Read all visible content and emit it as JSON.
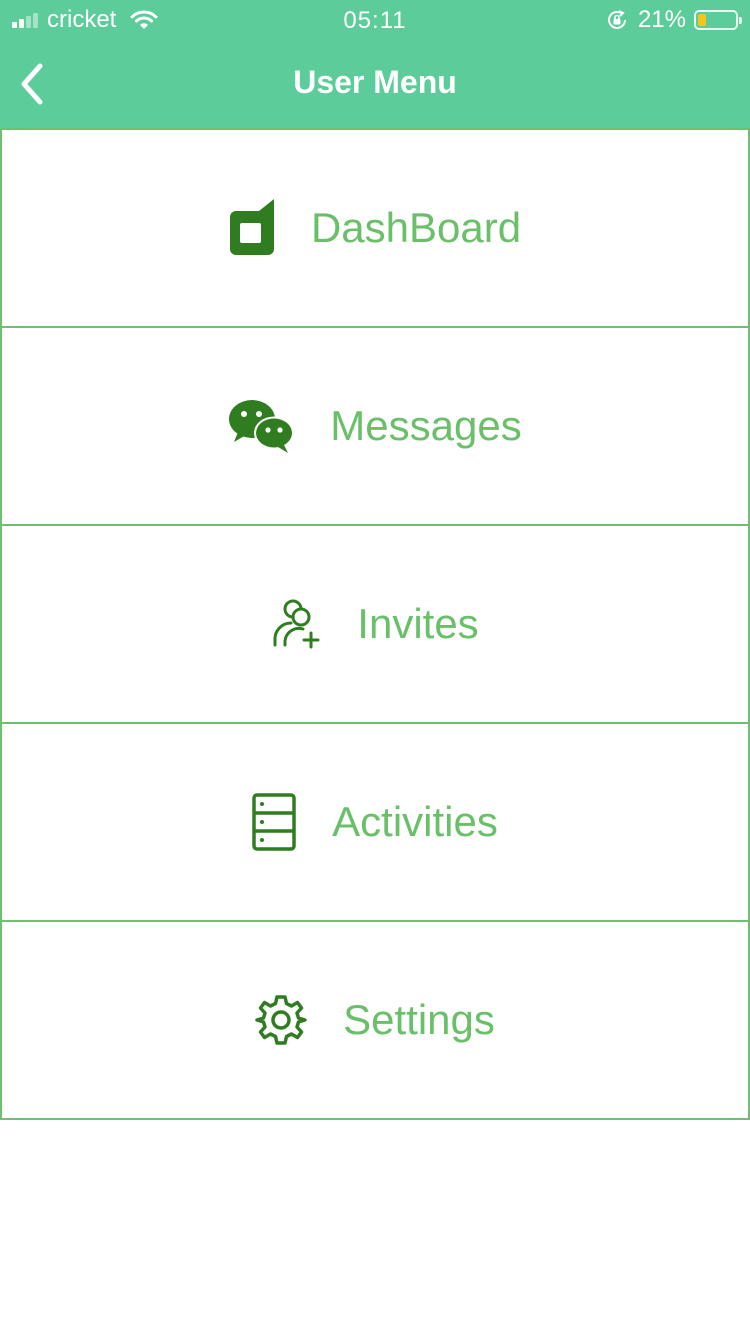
{
  "status_bar": {
    "carrier": "cricket",
    "time": "05:11",
    "battery_percent": "21%",
    "battery_level": 0.21,
    "colors": {
      "background": "#5ccc9a",
      "battery_fill": "#f5c518"
    }
  },
  "nav": {
    "title": "User Menu",
    "back_icon": "chevron-left-icon"
  },
  "menu": {
    "items": [
      {
        "label": "DashBoard",
        "icon": "dashboard-icon"
      },
      {
        "label": "Messages",
        "icon": "chat-bubbles-icon"
      },
      {
        "label": "Invites",
        "icon": "add-user-icon"
      },
      {
        "label": "Activities",
        "icon": "server-list-icon"
      },
      {
        "label": "Settings",
        "icon": "gear-icon"
      }
    ]
  },
  "colors": {
    "accent": "#5ccc9a",
    "label_green": "#6abf69",
    "icon_green": "#2f7d20",
    "border_green": "#6fbf73"
  }
}
